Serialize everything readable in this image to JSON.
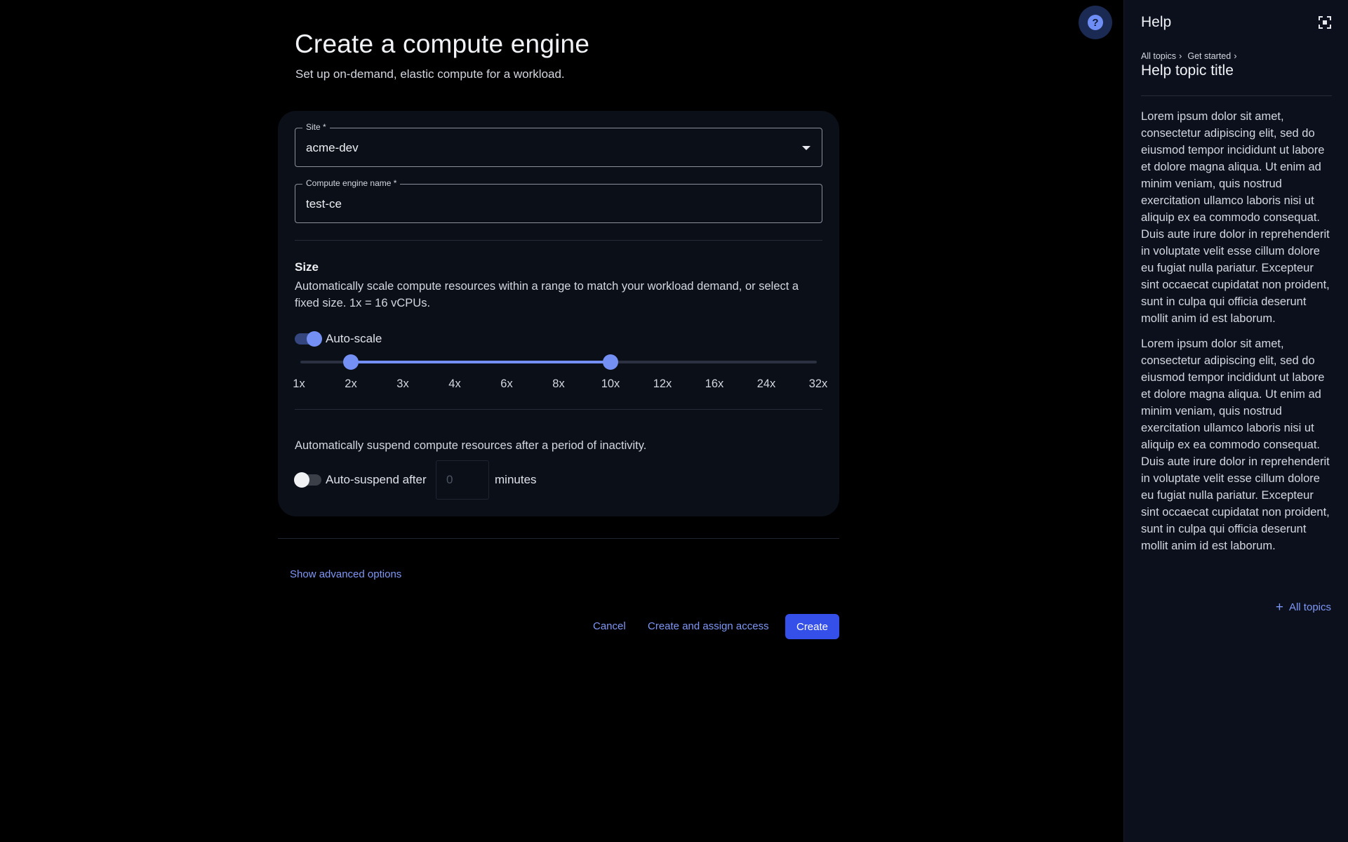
{
  "page": {
    "title": "Create a compute engine",
    "subtitle": "Set up on-demand, elastic compute for a workload."
  },
  "form": {
    "site": {
      "label": "Site *",
      "value": "acme-dev"
    },
    "name": {
      "label": "Compute engine name *",
      "value": "test-ce"
    },
    "size": {
      "title": "Size",
      "description": "Automatically scale compute resources within a range to match your workload demand, or select a fixed size. 1x = 16 vCPUs.",
      "autoscale_label": "Auto-scale",
      "autoscale_on": true,
      "ticks": [
        "1x",
        "2x",
        "3x",
        "4x",
        "6x",
        "8x",
        "10x",
        "12x",
        "16x",
        "24x",
        "32x"
      ],
      "range_min": "2x",
      "range_max": "10x"
    },
    "suspend": {
      "description": "Automatically suspend compute resources after a period of inactivity.",
      "label": "Auto-suspend after",
      "placeholder": "0",
      "unit": "minutes",
      "enabled": false
    }
  },
  "actions": {
    "advanced": "Show advanced options",
    "cancel": "Cancel",
    "create_assign": "Create and assign access",
    "create": "Create"
  },
  "help": {
    "title": "Help",
    "breadcrumb": [
      "All topics",
      "Get started"
    ],
    "topic_title": "Help topic title",
    "paragraphs": [
      "Lorem ipsum dolor sit amet, consectetur adipiscing elit, sed do eiusmod tempor incididunt ut labore et dolore magna aliqua. Ut enim ad minim veniam, quis nostrud exercitation ullamco laboris nisi ut aliquip ex ea commodo consequat. Duis aute irure dolor in reprehenderit in voluptate velit esse cillum dolore eu fugiat nulla pariatur. Excepteur sint occaecat cupidatat non proident, sunt in culpa qui officia deserunt mollit anim id est laborum.",
      "Lorem ipsum dolor sit amet, consectetur adipiscing elit, sed do eiusmod tempor incididunt ut labore et dolore magna aliqua. Ut enim ad minim veniam, quis nostrud exercitation ullamco laboris nisi ut aliquip ex ea commodo consequat. Duis aute irure dolor in reprehenderit in voluptate velit esse cillum dolore eu fugiat nulla pariatur. Excepteur sint occaecat cupidatat non proident, sunt in culpa qui officia deserunt mollit anim id est laborum."
    ],
    "all_topics": "All topics"
  },
  "colors": {
    "accent": "#7590f4",
    "primary_button": "#3550e8",
    "link": "#7f97f6",
    "card": "#0b0f18",
    "panel": "#0b101c"
  },
  "icons": {
    "help_fab": "question-circle-icon",
    "expand": "expand-icon",
    "dropdown": "chevron-down-icon",
    "all_topics": "plus-icon"
  }
}
